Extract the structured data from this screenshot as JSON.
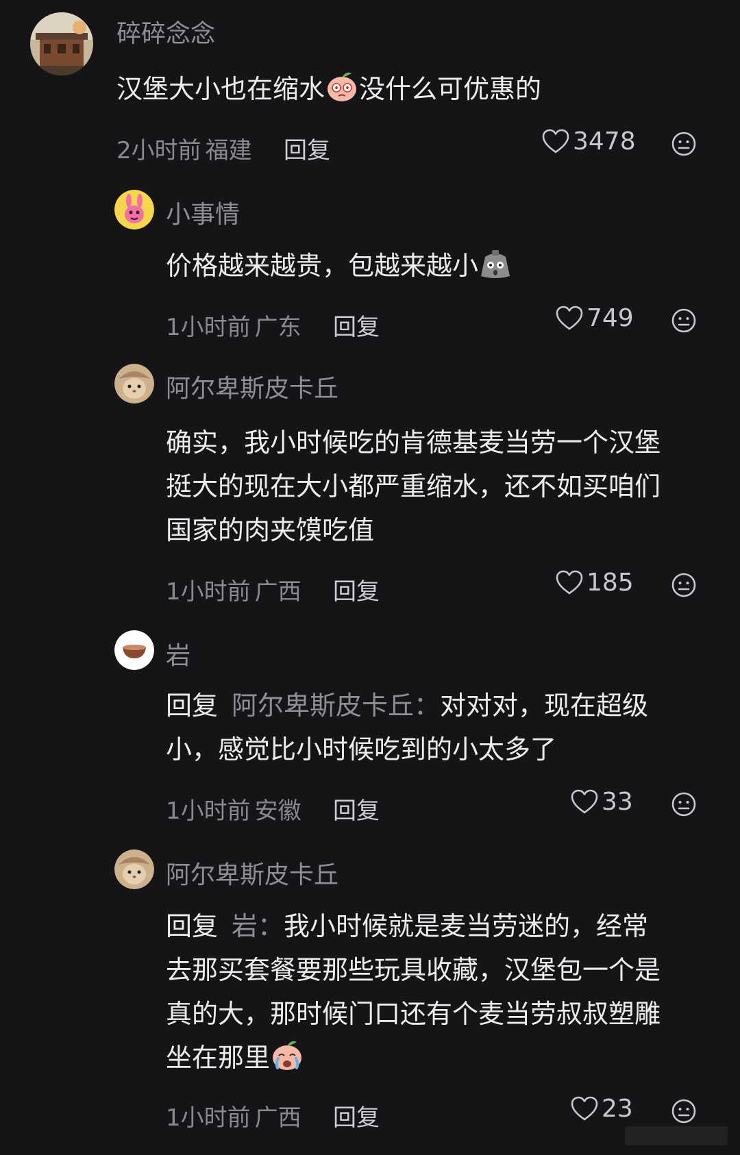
{
  "comments": [
    {
      "username": "碎碎念念",
      "text_before_emoji": "汉堡大小也在缩水",
      "emoji": "peach-dizzy-emoji",
      "text_after_emoji": "没什么可优惠的",
      "time": "2小时前",
      "location": "福建",
      "reply_label": "回复",
      "likes": "3478"
    },
    {
      "username": "小事情",
      "text_before_emoji": "价格越来越贵，包越来越小",
      "emoji": "shocked-bag-emoji",
      "text_after_emoji": "",
      "time": "1小时前",
      "location": "广东",
      "reply_label": "回复",
      "likes": "749"
    },
    {
      "username": "阿尔卑斯皮卡丘",
      "lines": [
        "确实，我小时候吃的肯德基麦当劳一个汉堡",
        "挺大的现在大小都严重缩水，还不如买咱们",
        "国家的肉夹馍吃值"
      ],
      "time": "1小时前",
      "location": "广西",
      "reply_label": "回复",
      "likes": "185"
    },
    {
      "username": "岩",
      "reply_prefix": "回复",
      "reply_target": "阿尔卑斯皮卡丘：",
      "line1_rest": "对对对，现在超级",
      "line2": "小，感觉比小时候吃到的小太多了",
      "time": "1小时前",
      "location": "安徽",
      "reply_label": "回复",
      "likes": "33"
    },
    {
      "username": "阿尔卑斯皮卡丘",
      "reply_prefix": "回复",
      "reply_target": "岩：",
      "line1_rest": "我小时候就是麦当劳迷的，经常",
      "line2": "去那买套餐要那些玩具收藏，汉堡包一个是",
      "line3": "真的大，那时候门口还有个麦当劳叔叔塑雕",
      "line4_before_emoji": "坐在那里",
      "emoji": "peach-crying-emoji",
      "time": "1小时前",
      "location": "广西",
      "reply_label": "回复",
      "likes": "23"
    }
  ],
  "icons": {
    "like": "heart-outline-icon",
    "dislike": "meh-face-icon"
  },
  "colors": {
    "background": "#151518",
    "primary_text": "#ececee",
    "secondary_text": "#8e8e93"
  }
}
